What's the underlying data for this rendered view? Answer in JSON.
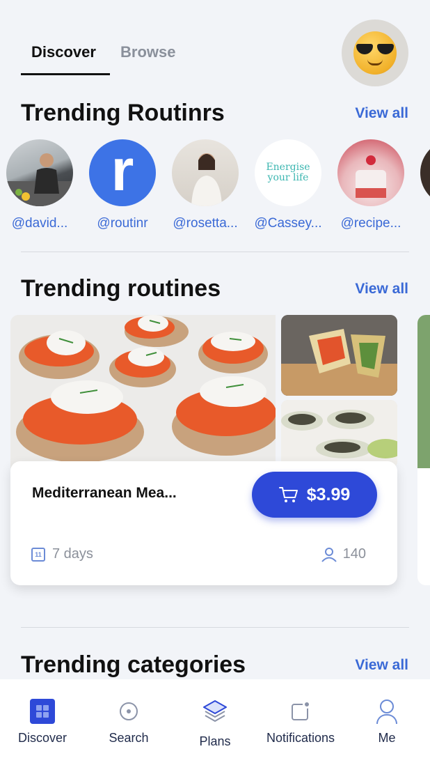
{
  "header": {
    "tabs": [
      {
        "label": "Discover",
        "active": true
      },
      {
        "label": "Browse",
        "active": false
      }
    ],
    "avatar_icon": "sunglasses-emoji-icon"
  },
  "trending_creators": {
    "title": "Trending Routinrs",
    "view_all": "View all",
    "items": [
      {
        "handle": "@david..."
      },
      {
        "handle": "@routinr",
        "avatar_letter": "r"
      },
      {
        "handle": "@rosetta..."
      },
      {
        "handle": "@Cassey...",
        "avatar_text": "Energise your life"
      },
      {
        "handle": "@recipe..."
      },
      {
        "handle": "@"
      }
    ]
  },
  "trending_routines": {
    "title": "Trending routines",
    "view_all": "View all",
    "cards": [
      {
        "title": "Mediterranean Mea...",
        "price": "$3.99",
        "duration": "7 days",
        "calendar_day": "11",
        "followers": "140"
      }
    ]
  },
  "trending_categories": {
    "title": "Trending categories",
    "view_all": "View all"
  },
  "bottom_nav": {
    "items": [
      {
        "label": "Discover",
        "icon": "grid-icon",
        "active": true
      },
      {
        "label": "Search",
        "icon": "search-icon",
        "active": false
      },
      {
        "label": "Plans",
        "icon": "layers-icon",
        "active": false
      },
      {
        "label": "Notifications",
        "icon": "notification-icon",
        "active": false
      },
      {
        "label": "Me",
        "icon": "profile-icon",
        "active": false
      }
    ]
  },
  "colors": {
    "accent": "#2e49d8",
    "link": "#3a69d6",
    "background": "#f2f4f8"
  }
}
